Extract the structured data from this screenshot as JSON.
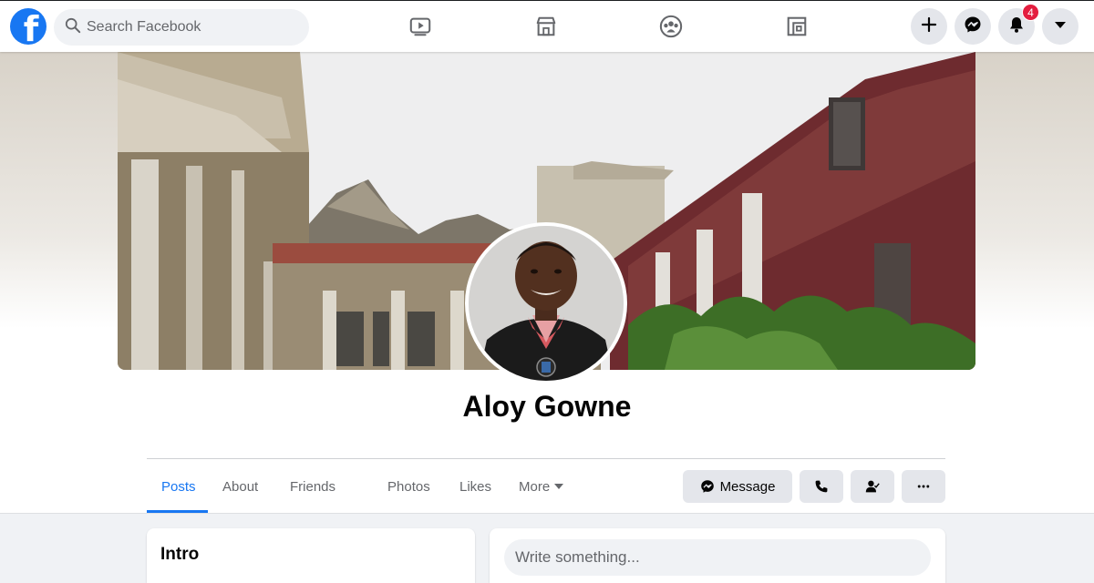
{
  "nav": {
    "search_placeholder": "Search Facebook",
    "notification_count": "4",
    "logo_letter": "f"
  },
  "profile": {
    "name": "Aloy Gowne"
  },
  "tabs": [
    {
      "label": "Posts",
      "active": true
    },
    {
      "label": "About"
    },
    {
      "label": "Friends"
    },
    {
      "label": "Photos"
    },
    {
      "label": "Likes"
    },
    {
      "label": "More"
    }
  ],
  "actions": {
    "message_label": "Message"
  },
  "intro": {
    "title": "Intro"
  },
  "composer": {
    "placeholder": "Write something..."
  },
  "colors": {
    "brand": "#1877f2",
    "badge": "#e41e3f",
    "button_bg": "#e4e6eb",
    "page_bg": "#f0f2f5"
  },
  "icons": [
    "search-icon",
    "watch-icon",
    "marketplace-icon",
    "groups-icon",
    "gaming-icon",
    "plus-icon",
    "messenger-icon",
    "bell-icon",
    "caret-down-icon",
    "phone-icon",
    "add-friend-icon",
    "more-dots-icon"
  ]
}
